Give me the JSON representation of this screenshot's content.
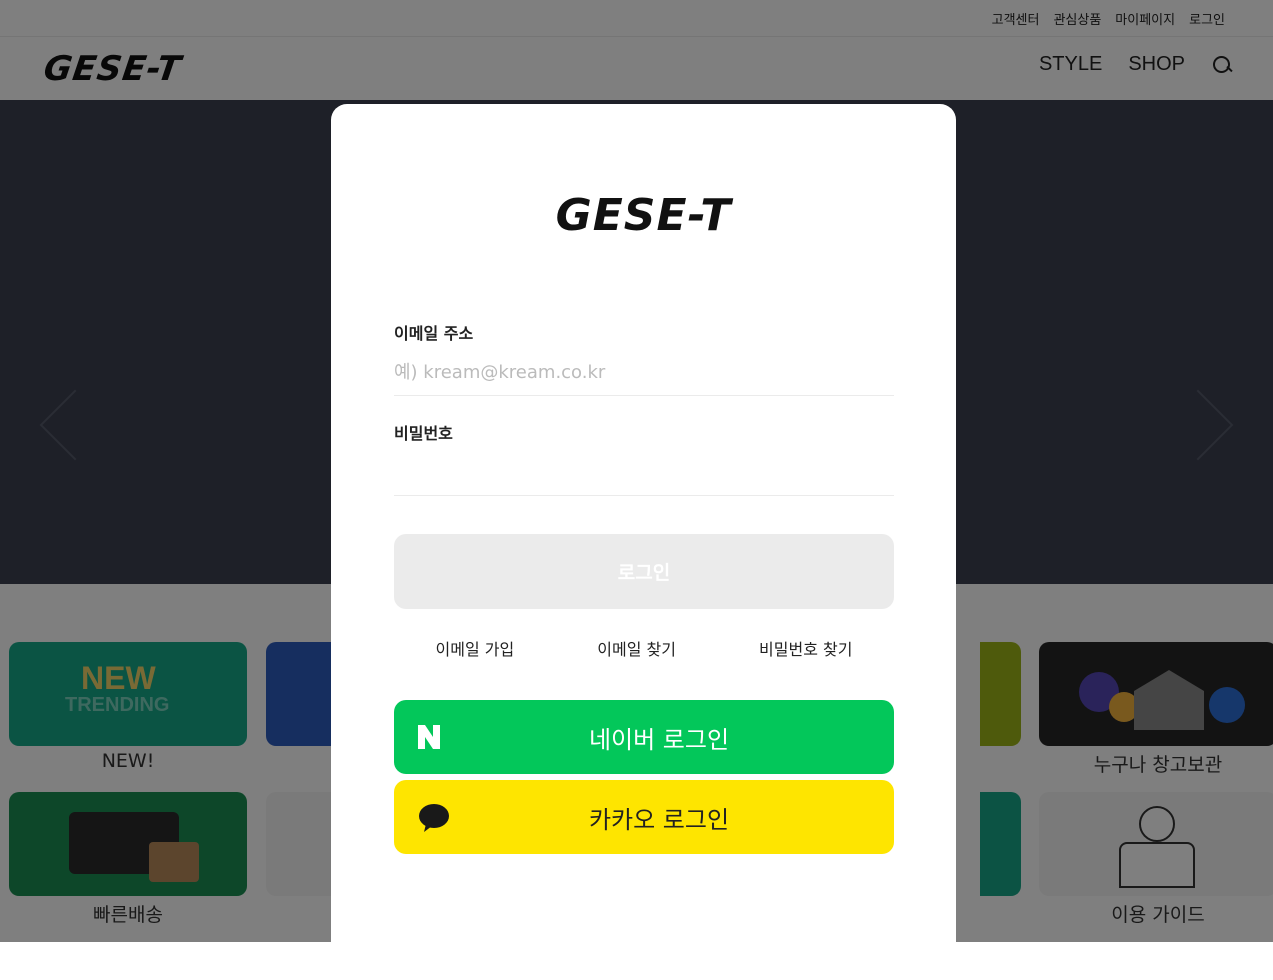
{
  "top_links": [
    "고객센터",
    "관심상품",
    "마이페이지",
    "로그인"
  ],
  "brand": "GESE-T",
  "main_nav": [
    "STYLE",
    "SHOP"
  ],
  "shortcuts": {
    "new_label": "NEW!",
    "new_art_title": "NEW",
    "new_art_subtitle": "TRENDING",
    "storage_label": "누구나 창고보관",
    "fast_delivery_label": "빠른배송",
    "guide_label": "이용 가이드"
  },
  "login": {
    "email_label": "이메일 주소",
    "email_placeholder": "예) kream@kream.co.kr",
    "password_label": "비밀번호",
    "submit_label": "로그인",
    "links": [
      "이메일 가입",
      "이메일 찾기",
      "비밀번호 찾기"
    ],
    "naver_label": "네이버 로그인",
    "kakao_label": "카카오 로그인"
  },
  "colors": {
    "overlay": "rgba(0,0,0,0.5)",
    "naver": "#03c75a",
    "kakao": "#fee500",
    "login_disabled": "#ebebeb"
  }
}
